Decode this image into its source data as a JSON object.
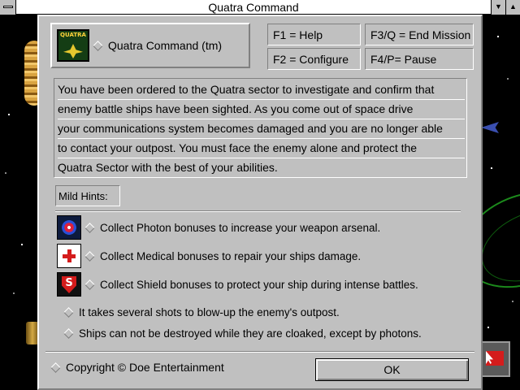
{
  "window": {
    "title": "Quatra Command"
  },
  "dialog": {
    "app_name": "Quatra Command (tm)",
    "logo_text": "QUATRA",
    "keys": {
      "help": "F1 = Help",
      "configure": "F2 = Configure",
      "end_mission": "F3/Q = End Mission",
      "pause": "F4/P= Pause"
    },
    "story": [
      "You have been ordered to the Quatra sector to investigate and confirm that",
      "enemy battle ships have been sighted.   As you come out of space drive",
      "your communications system becomes damaged and you are no longer able",
      "to contact your outpost.   You must face the enemy alone and protect the",
      "Quatra Sector with the best of your abilities."
    ],
    "hints_label": "Mild Hints:",
    "hints": [
      {
        "icon": "photon-bonus-icon",
        "text": "Collect Photon bonuses to increase your weapon arsenal."
      },
      {
        "icon": "medical-bonus-icon",
        "text": "Collect Medical bonuses to repair your ships damage."
      },
      {
        "icon": "shield-bonus-icon",
        "text": "Collect Shield bonuses to protect your ship during intense battles."
      }
    ],
    "notes": [
      "It takes several shots to blow-up the enemy's outpost.",
      "Ships can not be destroyed while they are cloaked, except by photons."
    ],
    "copyright": "Copyright © Doe Entertainment",
    "ok_label": "OK"
  },
  "colors": {
    "dialog_face": "#c0c0c0",
    "highlight": "#ffffff",
    "shadow": "#808080",
    "background": "#000000"
  }
}
